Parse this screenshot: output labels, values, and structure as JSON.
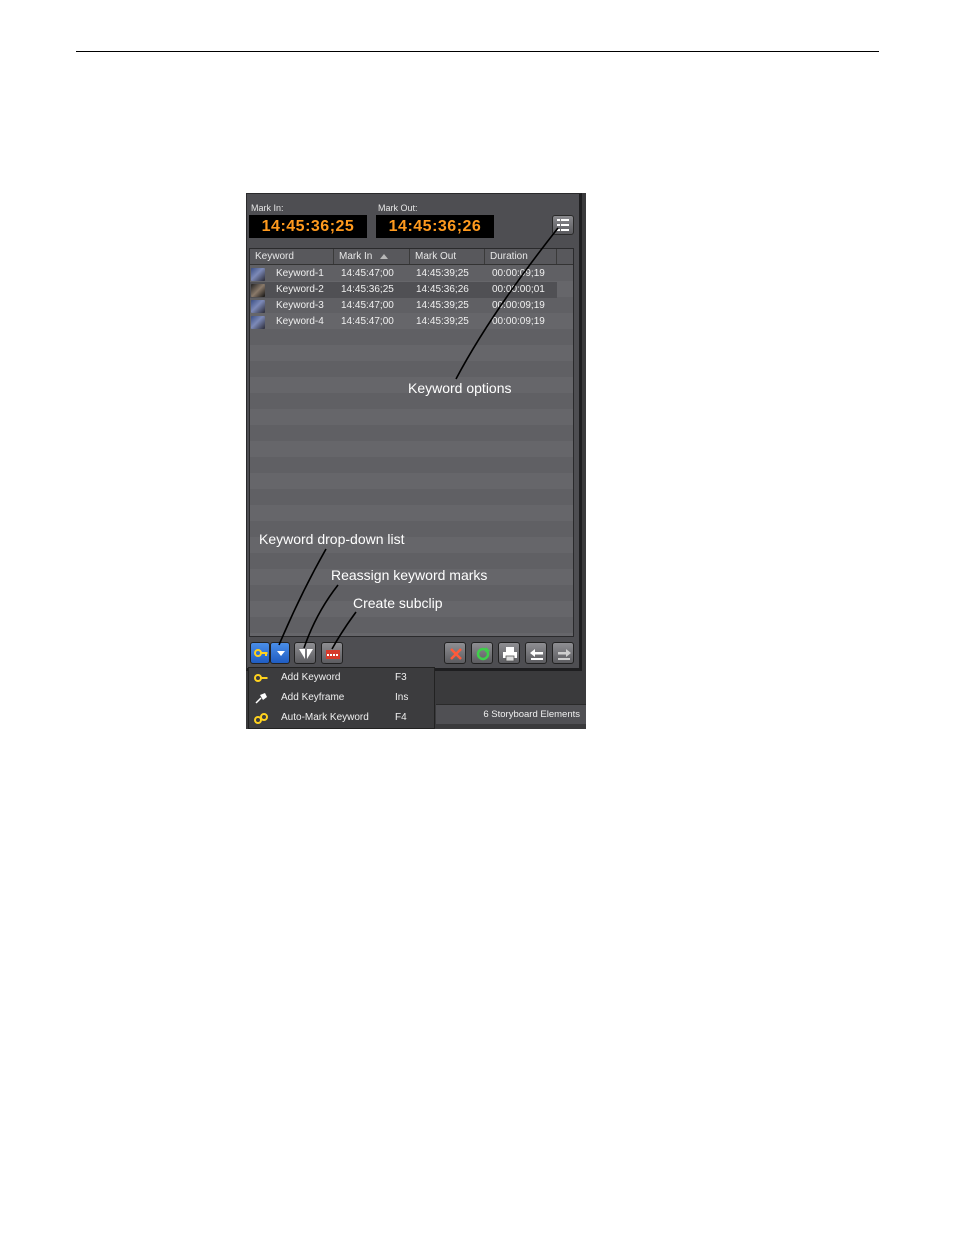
{
  "mark_in": {
    "label": "Mark In:",
    "timecode": "14:45:36;25"
  },
  "mark_out": {
    "label": "Mark Out:",
    "timecode": "14:45:36;26"
  },
  "columns": {
    "keyword": "Keyword",
    "mark_in": "Mark In",
    "mark_out": "Mark Out",
    "duration": "Duration"
  },
  "rows": [
    {
      "keyword": "Keyword-1",
      "mark_in": "14:45:47;00",
      "mark_out": "14:45:39;25",
      "duration": "00:00:09;19"
    },
    {
      "keyword": "Keyword-2",
      "mark_in": "14:45:36;25",
      "mark_out": "14:45:36;26",
      "duration": "00:00:00;01"
    },
    {
      "keyword": "Keyword-3",
      "mark_in": "14:45:47;00",
      "mark_out": "14:45:39;25",
      "duration": "00:00:09;19"
    },
    {
      "keyword": "Keyword-4",
      "mark_in": "14:45:47;00",
      "mark_out": "14:45:39;25",
      "duration": "00:00:09;19"
    }
  ],
  "annotations": {
    "keyword_options": "Keyword options",
    "keyword_dropdown": "Keyword drop-down list",
    "reassign_marks": "Reassign keyword marks",
    "create_subclip": "Create subclip"
  },
  "menu": [
    {
      "label": "Add Keyword",
      "shortcut": "F3",
      "icon": "key-icon"
    },
    {
      "label": "Add Keyframe",
      "shortcut": "Ins",
      "icon": "pin-icon"
    },
    {
      "label": "Auto-Mark Keyword",
      "shortcut": "F4",
      "icon": "auto-mark-icon"
    }
  ],
  "status": {
    "storyboard_count": "6 Storyboard Elements"
  },
  "colors": {
    "timecode": "#ff9a1e",
    "accent_blue": "#1f5cc2"
  }
}
